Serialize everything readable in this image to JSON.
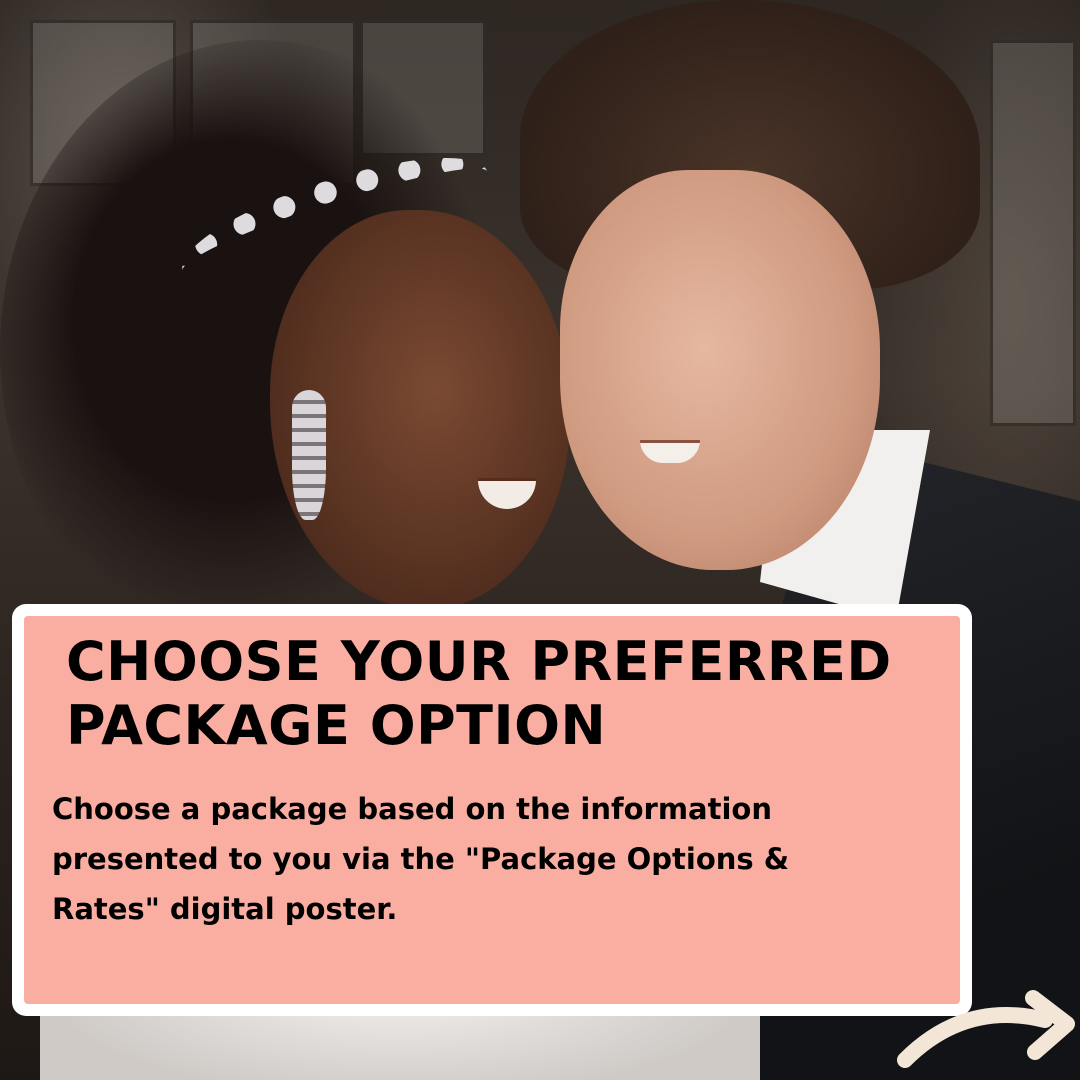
{
  "card": {
    "headline_line1": "CHOOSE YOUR PREFERRED",
    "headline_line2": "PACKAGE OPTION",
    "body": "Choose a package based on the information presented to you via the \"Package Options & Rates\" digital poster."
  },
  "colors": {
    "card_fill": "#f9aea1",
    "card_border": "#ffffff",
    "text": "#000000",
    "arrow": "#f3e6d6"
  },
  "icons": {
    "next": "curved-arrow-right-icon"
  }
}
